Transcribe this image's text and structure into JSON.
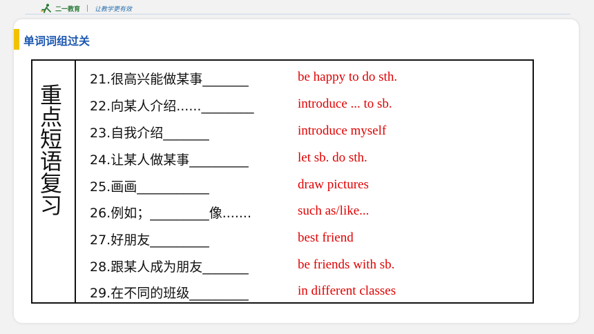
{
  "header": {
    "logo_text": "二一教育",
    "slogan": "让教学更有效"
  },
  "section": {
    "title": "单词词组过关"
  },
  "table": {
    "side_title": [
      "重",
      "点",
      "短",
      "语",
      "复",
      "习"
    ],
    "rows": [
      {
        "cn": "21.很高兴能做某事_______",
        "en": "be happy to do sth."
      },
      {
        "cn": "22.向某人介绍......________",
        "en": "introduce ... to sb."
      },
      {
        "cn": "23.自我介绍_______",
        "en": "introduce myself"
      },
      {
        "cn": "24.让某人做某事_________",
        "en": "let sb. do sth."
      },
      {
        "cn": "25.画画___________",
        "en": "draw pictures"
      },
      {
        "cn": "26.例如；_________像.......",
        "en": "such as/like..."
      },
      {
        "cn": "27.好朋友_________",
        "en": "best friend"
      },
      {
        "cn": "28.跟某人成为朋友_______",
        "en": "be friends with sb."
      },
      {
        "cn": "29.在不同的班级_________",
        "en": "in different classes"
      }
    ]
  },
  "colors": {
    "accent": "#f2c200",
    "title_blue": "#1a56b0",
    "answer_red": "#e00000"
  }
}
